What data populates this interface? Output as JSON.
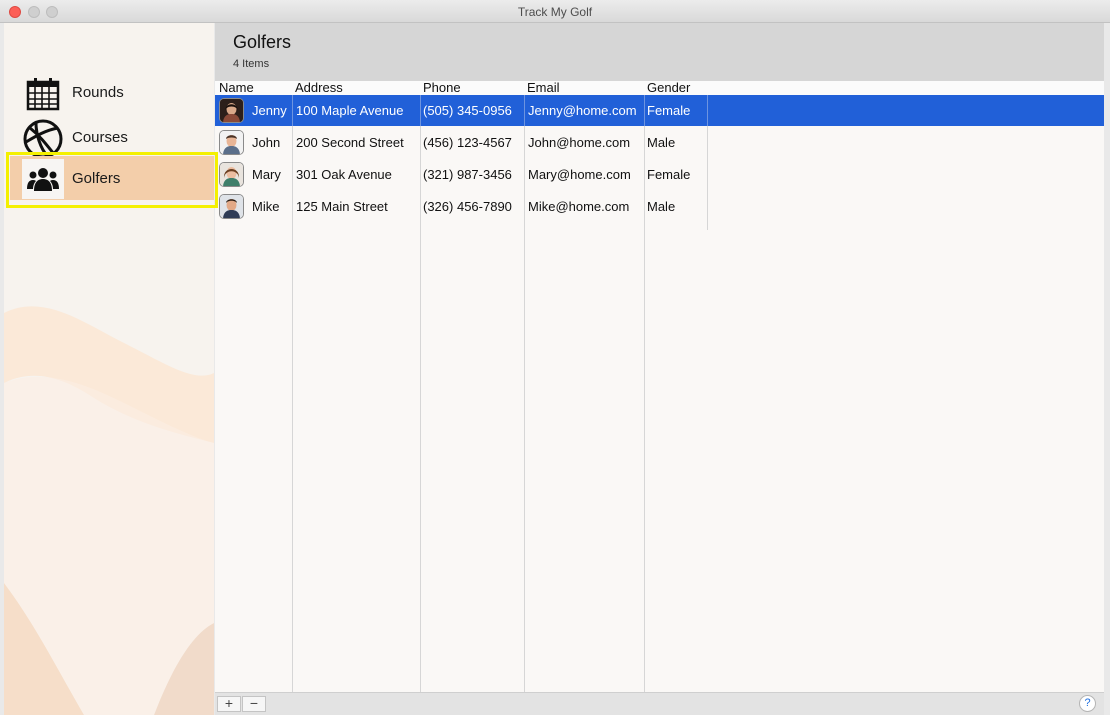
{
  "window": {
    "title": "Track My Golf"
  },
  "sidebar": {
    "items": [
      {
        "label": "Rounds",
        "icon": "calendar-icon"
      },
      {
        "label": "Courses",
        "icon": "globe-icon"
      },
      {
        "label": "Golfers",
        "icon": "people-icon",
        "selected": true
      }
    ]
  },
  "main": {
    "title": "Golfers",
    "count": "4 Items",
    "columns": [
      "Name",
      "Address",
      "Phone",
      "Email",
      "Gender"
    ],
    "rows": [
      {
        "name": "Jenny",
        "address": "100 Maple Avenue",
        "phone": "(505) 345-0956",
        "email": "Jenny@home.com",
        "gender": "Female",
        "selected": true
      },
      {
        "name": "John",
        "address": "200 Second Street",
        "phone": "(456) 123-4567",
        "email": "John@home.com",
        "gender": "Male"
      },
      {
        "name": "Mary",
        "address": "301 Oak Avenue",
        "phone": "(321) 987-3456",
        "email": "Mary@home.com",
        "gender": "Female"
      },
      {
        "name": "Mike",
        "address": "125 Main Street",
        "phone": "(326) 456-7890",
        "email": "Mike@home.com",
        "gender": "Male"
      }
    ]
  },
  "bottom": {
    "add_label": "+",
    "remove_label": "−",
    "help_label": "?"
  },
  "colors": {
    "selection": "#2160d8",
    "sidebar_selected": "#f3ceaa",
    "highlight": "#f4f000"
  }
}
